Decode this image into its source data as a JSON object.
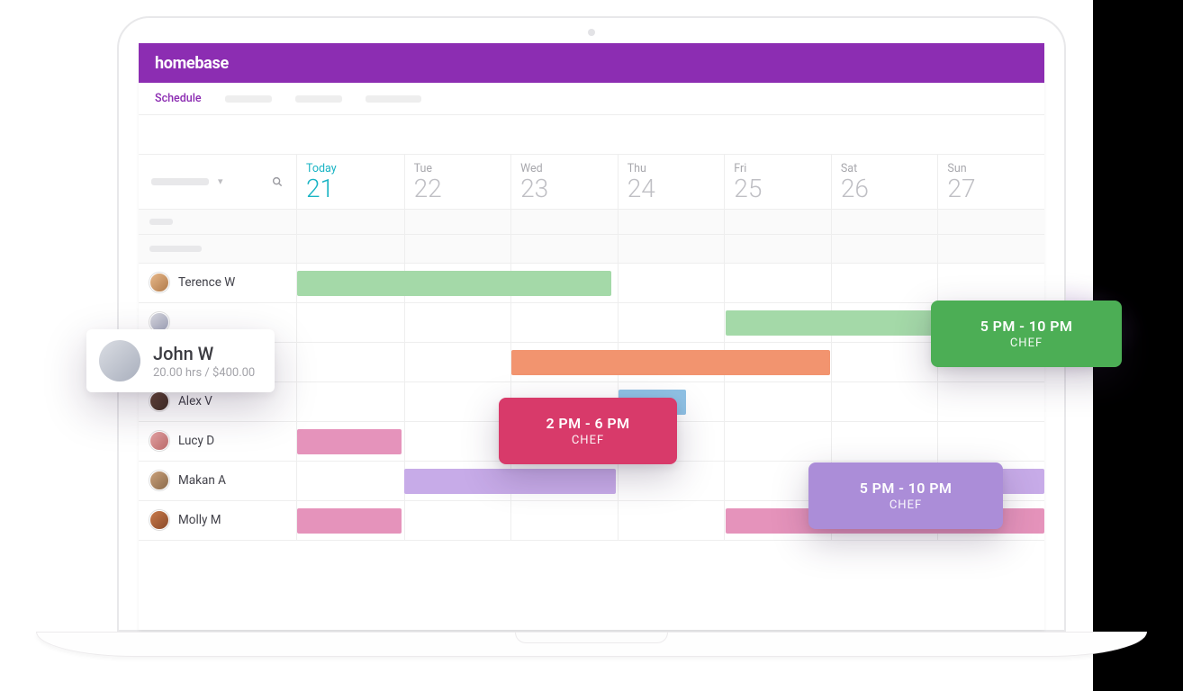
{
  "brand": "homebase",
  "nav": {
    "active": "Schedule"
  },
  "days": [
    {
      "label": "Today",
      "num": "21",
      "today": true
    },
    {
      "label": "Tue",
      "num": "22"
    },
    {
      "label": "Wed",
      "num": "23"
    },
    {
      "label": "Thu",
      "num": "24"
    },
    {
      "label": "Fri",
      "num": "25"
    },
    {
      "label": "Sat",
      "num": "26"
    },
    {
      "label": "Sun",
      "num": "27"
    }
  ],
  "employees": [
    {
      "name": "Terence W"
    },
    {
      "name": ""
    },
    {
      "name": ""
    },
    {
      "name": "Alex V"
    },
    {
      "name": "Lucy D"
    },
    {
      "name": "Makan A"
    },
    {
      "name": "Molly M"
    }
  ],
  "popouts": {
    "red": {
      "time": "2 PM - 6 PM",
      "role": "CHEF"
    },
    "green": {
      "time": "5 PM - 10 PM",
      "role": "CHEF"
    },
    "purple": {
      "time": "5 PM - 10 PM",
      "role": "CHEF"
    }
  },
  "person_card": {
    "name": "John W",
    "meta": "20.00 hrs / $400.00"
  }
}
